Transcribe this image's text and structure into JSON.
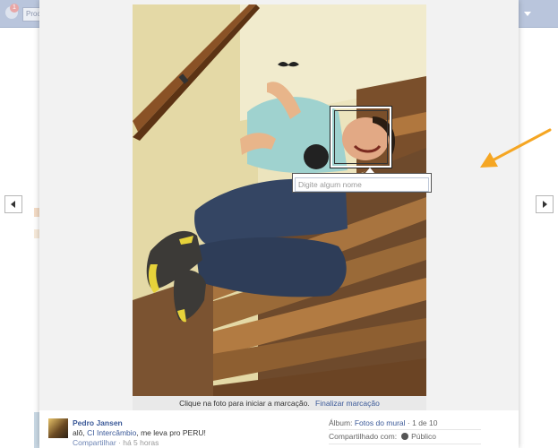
{
  "background_page": {
    "notification_count": "1",
    "search_placeholder": "Proc"
  },
  "photo": {
    "tag_prompt": "Clique na foto para iniciar a marcação.",
    "finish_tagging_label": "Finalizar marcação",
    "tag_input_placeholder": "Digite algum nome"
  },
  "post": {
    "author": "Pedro Jansen",
    "text_prefix": "alô,",
    "mention": "CI Intercâmbio",
    "text_suffix": ", me leva pro PERU!",
    "share_label": "Compartilhar",
    "time": "· há 5 horas"
  },
  "album": {
    "label": "Álbum:",
    "name": "Fotos do mural",
    "position": "· 1 de 10",
    "shared_label": "Compartilhado com:",
    "audience": "Público"
  },
  "colors": {
    "link": "#3b5998",
    "annotation_arrow": "#f5a623"
  },
  "icons": {
    "prev": "chevron-left-icon",
    "next": "chevron-right-icon",
    "audience": "globe-icon"
  }
}
